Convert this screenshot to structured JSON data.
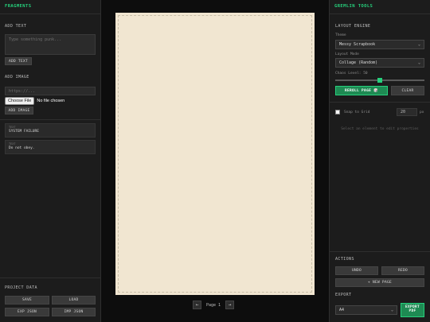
{
  "left_panel": {
    "title": "FRAGMENTS",
    "add_text": {
      "section_title": "ADD TEXT",
      "placeholder": "Type something punk...",
      "button": "ADD TEXT"
    },
    "add_image": {
      "section_title": "ADD IMAGE",
      "url_placeholder": "https://...",
      "file_button": "Choose File",
      "file_status": "No file chosen",
      "button": "ADD IMAGE"
    },
    "fragments": [
      {
        "tag": "TEXT",
        "text": "SYSTEM FAILURE"
      },
      {
        "tag": "TEXT",
        "text": "Do not obey."
      }
    ],
    "project": {
      "section_title": "PROJECT DATA",
      "save": "SAVE",
      "load": "LOAD",
      "exp_json": "EXP JSON",
      "imp_json": "IMP JSON"
    }
  },
  "canvas": {
    "page_label": "Page 1",
    "prev": "←",
    "next": "→"
  },
  "right_panel": {
    "title": "GREMLIN TOOLS",
    "layout_engine": {
      "section_title": "LAYOUT ENGINE",
      "theme_label": "Theme",
      "theme_value": "Messy Scrapbook",
      "mode_label": "Layout Mode",
      "mode_value": "Collage (Random)",
      "chaos_label": "Chaos Level: 50",
      "chaos_level": 50,
      "reroll": "REROLL PAGE 🎲",
      "clear": "CLEAR"
    },
    "grid": {
      "snap_label": "Snap to Grid",
      "grid_size": "20",
      "unit": "px",
      "hint": "Select an element to edit properties"
    },
    "actions": {
      "section_title": "ACTIONS",
      "undo": "UNDO",
      "redo": "REDO",
      "new_page": "+ NEW PAGE"
    },
    "export": {
      "section_title": "EXPORT",
      "paper_size": "A4",
      "export_pdf": "EXPORT PDF"
    }
  },
  "colors": {
    "accent": "#26d07c",
    "panel": "#1c1c1c",
    "paper": "#f1e6d1",
    "background": "#0d0d0d"
  }
}
